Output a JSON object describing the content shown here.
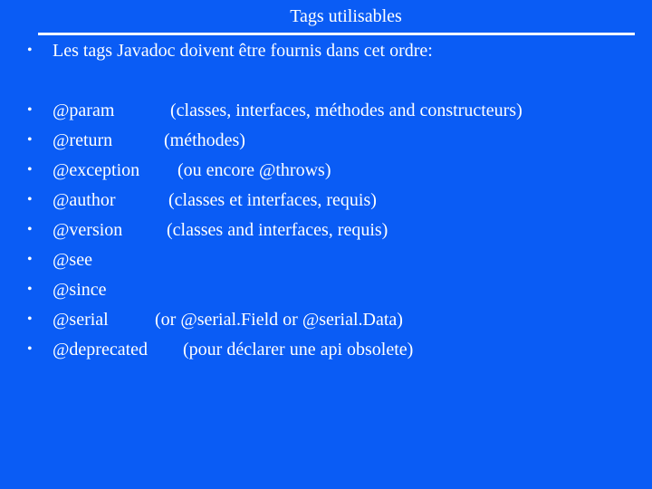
{
  "title": "Tags utilisables",
  "intro": {
    "bullet": "•",
    "text": "Les tags Javadoc doivent être fournis dans cet ordre:"
  },
  "tags": [
    {
      "bullet": "•",
      "tag": "@param",
      "desc": "(classes, interfaces, méthodes and constructeurs)"
    },
    {
      "bullet": "•",
      "tag": "@return",
      "desc": "(méthodes)"
    },
    {
      "bullet": "•",
      "tag": "@exception",
      "desc": "(ou encore @throws)"
    },
    {
      "bullet": "•",
      "tag": "@author",
      "desc": "(classes et interfaces, requis)"
    },
    {
      "bullet": "•",
      "tag": "@version",
      "desc": "(classes and interfaces, requis)"
    },
    {
      "bullet": "•",
      "tag": "@see",
      "desc": ""
    },
    {
      "bullet": "•",
      "tag": "@since",
      "desc": ""
    },
    {
      "bullet": "•",
      "tag": "@serial",
      "desc": "(or @serial.Field or @serial.Data)"
    },
    {
      "bullet": "•",
      "tag": "@deprecated",
      "desc": "(pour déclarer une api obsolete)"
    }
  ]
}
